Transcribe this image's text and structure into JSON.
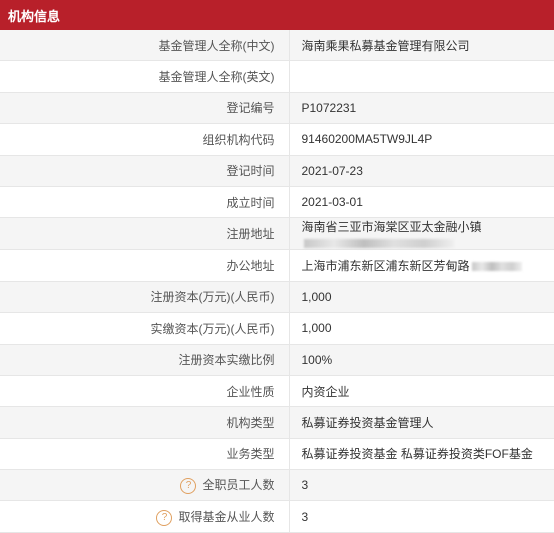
{
  "header": {
    "title": "机构信息"
  },
  "rows": [
    {
      "label": "基金管理人全称(中文)",
      "value": "海南乘果私募基金管理有限公司"
    },
    {
      "label": "基金管理人全称(英文)",
      "value": ""
    },
    {
      "label": "登记编号",
      "value": "P1072231"
    },
    {
      "label": "组织机构代码",
      "value": "91460200MA5TW9JL4P"
    },
    {
      "label": "登记时间",
      "value": "2021-07-23"
    },
    {
      "label": "成立时间",
      "value": "2021-03-01"
    },
    {
      "label": "注册地址",
      "value": "海南省三亚市海棠区亚太金融小镇"
    },
    {
      "label": "办公地址",
      "value": "上海市浦东新区浦东新区芳甸路"
    },
    {
      "label": "注册资本(万元)(人民币)",
      "value": "1,000"
    },
    {
      "label": "实缴资本(万元)(人民币)",
      "value": "1,000"
    },
    {
      "label": "注册资本实缴比例",
      "value": "100%"
    },
    {
      "label": "企业性质",
      "value": "内资企业"
    },
    {
      "label": "机构类型",
      "value": "私募证券投资基金管理人"
    },
    {
      "label": "业务类型",
      "value": "私募证券投资基金 私募证券投资类FOF基金"
    },
    {
      "label": "全职员工人数",
      "value": "3"
    },
    {
      "label": "取得基金从业人数",
      "value": "3"
    }
  ],
  "help_icon": "question-circle-icon",
  "colors": {
    "header_bg": "#b8202a",
    "help_icon": "#e0a060"
  }
}
